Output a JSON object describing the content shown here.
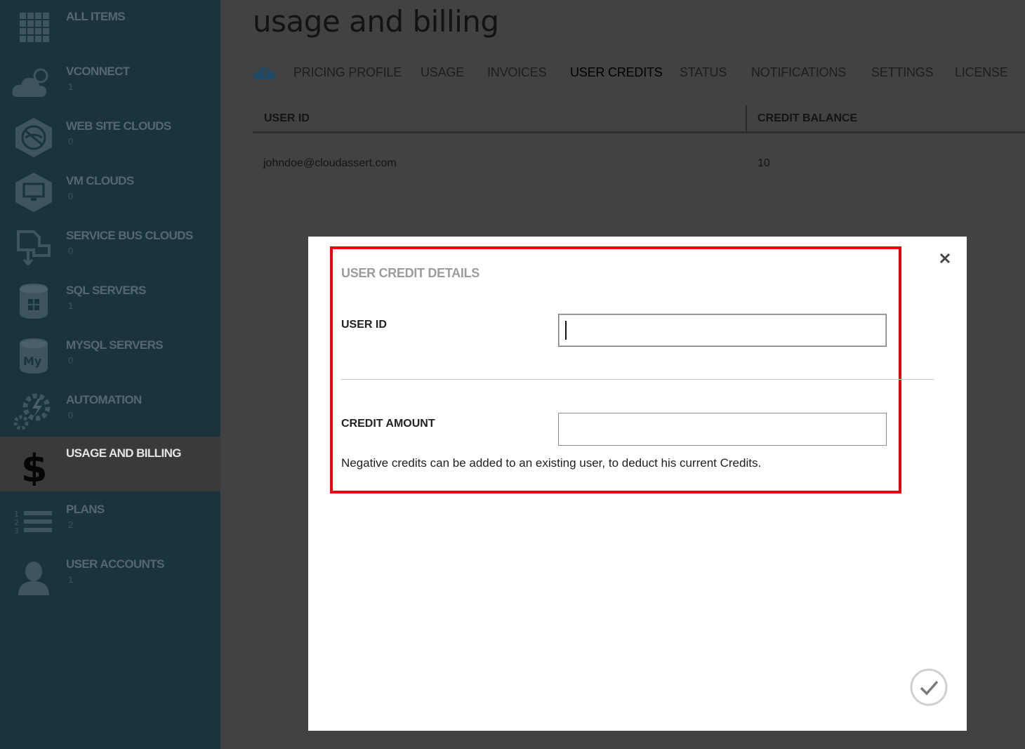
{
  "sidebar": {
    "items": [
      {
        "label": "ALL ITEMS",
        "count": "",
        "icon": "grid-icon"
      },
      {
        "label": "VCONNECT",
        "count": "1",
        "icon": "cloud-sun-icon"
      },
      {
        "label": "WEB SITE CLOUDS",
        "count": "0",
        "icon": "globe-hex-icon"
      },
      {
        "label": "VM CLOUDS",
        "count": "0",
        "icon": "monitor-hex-icon"
      },
      {
        "label": "SERVICE BUS CLOUDS",
        "count": "0",
        "icon": "service-bus-icon"
      },
      {
        "label": "SQL SERVERS",
        "count": "1",
        "icon": "database-windows-icon"
      },
      {
        "label": "MYSQL SERVERS",
        "count": "0",
        "icon": "database-mysql-icon"
      },
      {
        "label": "AUTOMATION",
        "count": "0",
        "icon": "gear-lightning-icon"
      },
      {
        "label": "USAGE AND BILLING",
        "count": "",
        "icon": "dollar-icon"
      },
      {
        "label": "PLANS",
        "count": "2",
        "icon": "numbered-list-icon"
      },
      {
        "label": "USER ACCOUNTS",
        "count": "1",
        "icon": "user-icon"
      }
    ]
  },
  "page": {
    "title": "usage and billing"
  },
  "tabs": {
    "items": [
      "PRICING PROFILE",
      "USAGE",
      "INVOICES",
      "USER CREDITS",
      "STATUS",
      "NOTIFICATIONS",
      "SETTINGS",
      "LICENSE"
    ],
    "active": "USER CREDITS"
  },
  "grid": {
    "columns": [
      "USER ID",
      "CREDIT BALANCE"
    ],
    "rows": [
      [
        "johndoe@cloudassert.com",
        "10"
      ]
    ]
  },
  "dialog": {
    "title": "USER CREDIT DETAILS",
    "user_id_label": "USER ID",
    "user_id_value": "",
    "credit_amount_label": "CREDIT AMOUNT",
    "credit_amount_value": "",
    "hint": "Negative credits can be added to an existing user, to deduct his current Credits.",
    "highlight_color": "#e8000d"
  },
  "colors": {
    "sidebar": "#1b333f",
    "overlay": "#424242",
    "dialog": "#ffffff"
  }
}
